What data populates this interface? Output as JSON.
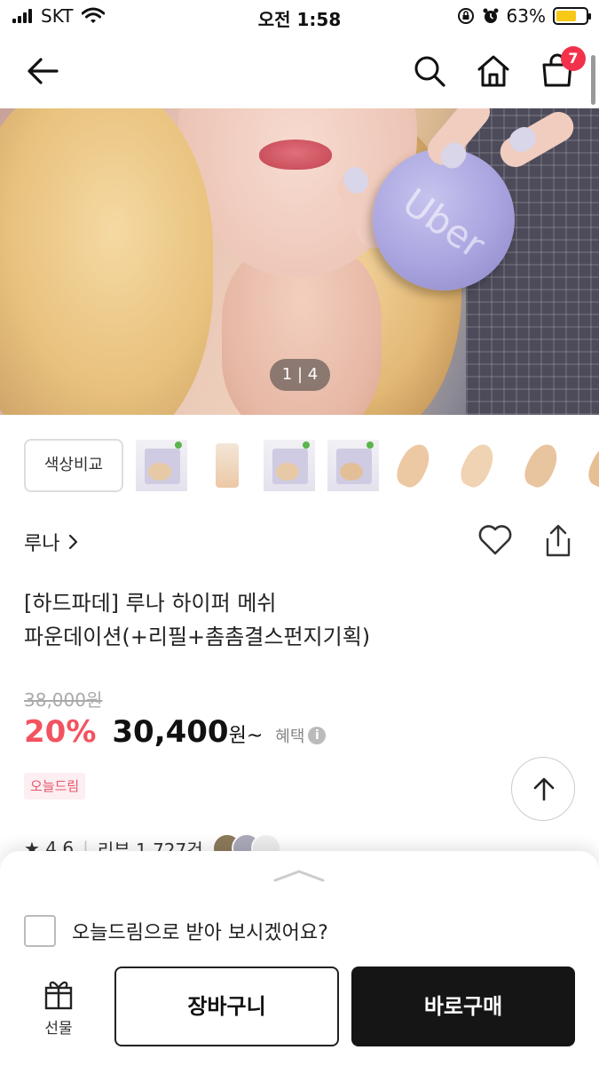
{
  "status_bar": {
    "carrier": "SKT",
    "time": "오전 1:58",
    "battery_percent": "63%",
    "battery_level": 0.63
  },
  "nav": {
    "cart_count": "7"
  },
  "hero": {
    "image_counter": "1 | 4",
    "compact_text": "Uber"
  },
  "thumbnails": {
    "compare_label": "색상비교"
  },
  "product": {
    "brand": "루나",
    "title_line1": "[하드파데] 루나 하이퍼 메쉬",
    "title_line2": "파운데이션(+리필+촘촘결스펀지기획)",
    "original_price": "38,000원",
    "discount": "20%",
    "price": "30,400",
    "price_unit": "원~",
    "benefit_label": "혜택",
    "delivery_tag": "오늘드림",
    "rating_prefix": "★ 4.6",
    "review_text": "리뷰 1,727건"
  },
  "bottom_sheet": {
    "today_dream_question": "오늘드림으로 받아 보시겠어요?",
    "gift_label": "선물",
    "cart_label": "장바구니",
    "buy_label": "바로구매"
  },
  "colors": {
    "accent_red": "#f25360",
    "badge_red": "#f2324a",
    "tag_bg": "#fdeef1",
    "buy_bg": "#151515"
  }
}
